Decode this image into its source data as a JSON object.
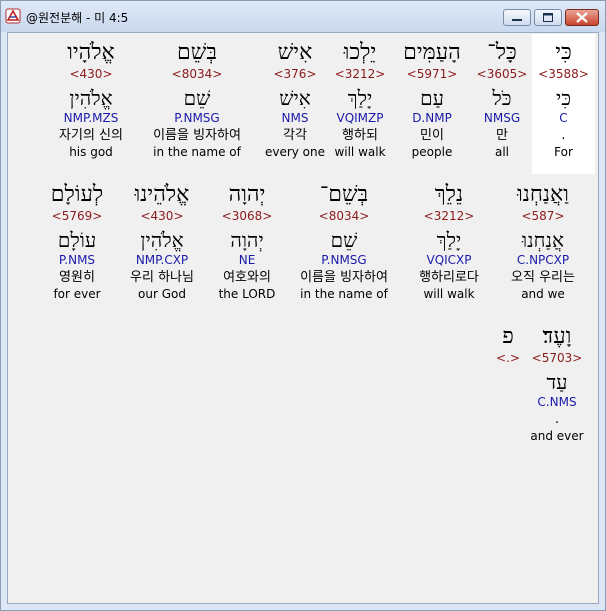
{
  "window": {
    "title": "@원전분해 - 미 4:5"
  },
  "verse": [
    {
      "heb": "כִּי",
      "num": "<3588>",
      "lemma": "כִּי",
      "morph": "C",
      "kor": ".",
      "eng": "For"
    },
    {
      "heb": "כָּל־",
      "num": "<3605>",
      "lemma": "כֹּל",
      "morph": "NMSG",
      "kor": "만",
      "eng": "all"
    },
    {
      "heb": "הָעַמִּים",
      "num": "<5971>",
      "lemma": "עַם",
      "morph": "D.NMP",
      "kor": "민이",
      "eng": "people"
    },
    {
      "heb": "יֵלְכוּ",
      "num": "<3212>",
      "lemma": "יָלַךְ",
      "morph": "VQIMZP",
      "kor": "행하되",
      "eng": "will walk"
    },
    {
      "heb": "אִישׁ",
      "num": "<376>",
      "lemma": "אִישׁ",
      "morph": "NMS",
      "kor": "각각",
      "eng": "every one"
    },
    {
      "heb": "בְּשֵׁם",
      "num": "<8034>",
      "lemma": "שֵׁם",
      "morph": "P.NMSG",
      "kor": "이름을 빙자하여",
      "eng": "in the name of"
    },
    {
      "heb": "אֱלֹהָיו",
      "num": "<430>",
      "lemma": "אֱלֹהִין",
      "morph": "NMP.MZS",
      "kor": "자기의 신의",
      "eng": "his god"
    },
    {
      "heb": "וַאֲנַחְנוּ",
      "num": "<587>",
      "lemma": "אֲנַחְנוּ",
      "morph": "C.NPCXP",
      "kor": "오직 우리는",
      "eng": "and we"
    },
    {
      "heb": "נֵלֵךְ",
      "num": "<3212>",
      "lemma": "יָלַךְ",
      "morph": "VQICXP",
      "kor": "행하리로다",
      "eng": "will walk"
    },
    {
      "heb": "בְּשֵׁם־",
      "num": "<8034>",
      "lemma": "שֵׁם",
      "morph": "P.NMSG",
      "kor": "이름을 빙자하여",
      "eng": "in the name of"
    },
    {
      "heb": "יְהוָה",
      "num": "<3068>",
      "lemma": "יְהוָה",
      "morph": "NE",
      "kor": "여호와의",
      "eng": "the LORD"
    },
    {
      "heb": "אֱלֹהֵינוּ",
      "num": "<430>",
      "lemma": "אֱלֹהִין",
      "morph": "NMP.CXP",
      "kor": "우리 하나님",
      "eng": "our God"
    },
    {
      "heb": "לְעוֹלָם",
      "num": "<5769>",
      "lemma": "עוֹלָם",
      "morph": "P.NMS",
      "kor": "영원히",
      "eng": "for ever"
    },
    {
      "heb": "וָעֶד׃",
      "num": "<5703>",
      "lemma": "עַד",
      "morph": "C.NMS",
      "kor": ".",
      "eng": "and ever"
    },
    {
      "heb": "פ",
      "num": "<.>",
      "lemma": "",
      "morph": "",
      "kor": "",
      "eng": ""
    }
  ]
}
